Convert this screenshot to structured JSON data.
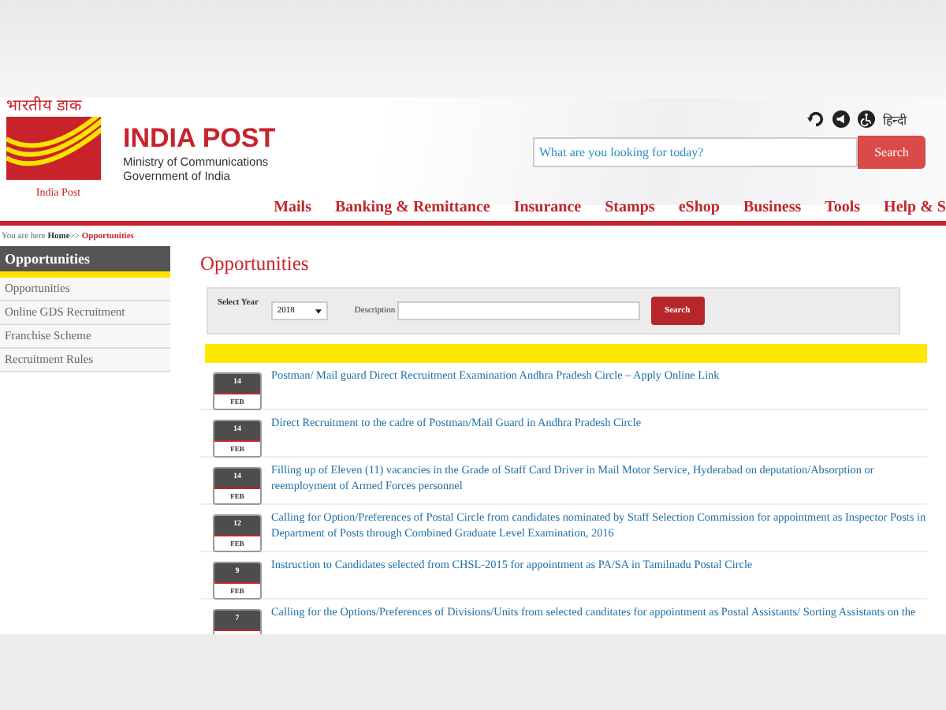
{
  "header": {
    "logo_hindi": "भारतीय डाक",
    "logo_caption": "India Post",
    "brand": "INDIA POST",
    "ministry": "Ministry of Communications",
    "government": "Government of India",
    "language_link": "हिन्दी",
    "search": {
      "placeholder": "What are you looking for today?",
      "button": "Search"
    }
  },
  "nav": [
    {
      "label": "Mails"
    },
    {
      "label": "Banking & Remittance"
    },
    {
      "label": "Insurance"
    },
    {
      "label": "Stamps"
    },
    {
      "label": "eShop"
    },
    {
      "label": "Business"
    },
    {
      "label": "Tools"
    },
    {
      "label": "Help & S"
    }
  ],
  "breadcrumb": {
    "prefix": "You are here",
    "home": "Home",
    "separator": ">>",
    "current": "Opportunities"
  },
  "sidebar": {
    "title": "Opportunities",
    "items": [
      {
        "label": "Opportunities"
      },
      {
        "label": "Online GDS Recruitment"
      },
      {
        "label": "Franchise Scheme"
      },
      {
        "label": "Recruitment Rules"
      }
    ]
  },
  "page_title": "Opportunities",
  "filter": {
    "year_label": "Select Year",
    "year": "2018",
    "description_label": "Description",
    "button": "Search"
  },
  "items": [
    {
      "day": "14",
      "month": "FEB",
      "title": "Postman/ Mail guard Direct Recruitment Examination Andhra Pradesh Circle – Apply Online Link"
    },
    {
      "day": "14",
      "month": "FEB",
      "title": "Direct Recruitment to the cadre of Postman/Mail Guard in Andhra Pradesh Circle"
    },
    {
      "day": "14",
      "month": "FEB",
      "title": "Filling up of Eleven (11) vacancies in the Grade of Staff Card Driver in Mail Motor Service, Hyderabad on deputation/Absorption or reemployment of Armed Forces personnel"
    },
    {
      "day": "12",
      "month": "FEB",
      "title": "Calling for Option/Preferences of Postal Circle from candidates nominated by Staff Selection Commission for appointment as Inspector Posts in Department of Posts through Combined Graduate Level Examination, 2016"
    },
    {
      "day": "9",
      "month": "FEB",
      "title": "Instruction to Candidates selected from CHSL-2015 for appointment as PA/SA in Tamilnadu Postal Circle"
    },
    {
      "day": "7",
      "title": "Calling for the Options/Preferences of Divisions/Units from selected canditates for appointment as Postal Assistants/ Sorting Assistants on the"
    }
  ]
}
